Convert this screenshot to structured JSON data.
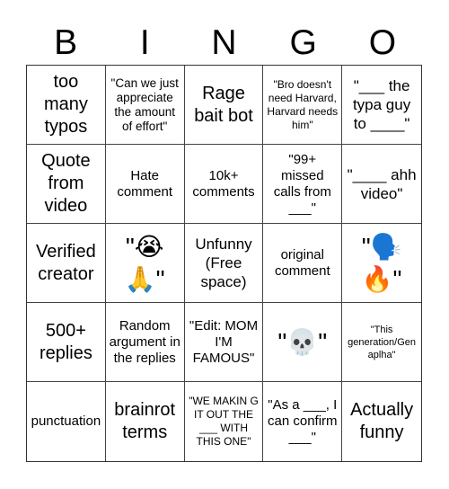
{
  "header": {
    "letters": [
      "B",
      "I",
      "N",
      "G",
      "O"
    ]
  },
  "cells": [
    {
      "text": "too many typos",
      "size": "xl"
    },
    {
      "text": "\"Can we just appreciate the amount of effort\"",
      "size": "sm"
    },
    {
      "text": "Rage bait bot",
      "size": "xl"
    },
    {
      "text": "\"Bro doesn't need Harvard, Harvard needs him\"",
      "size": "xs"
    },
    {
      "text": "\"___ the typa guy to ____\"",
      "size": "lg"
    },
    {
      "text": "Quote from video",
      "size": "xl"
    },
    {
      "text": "Hate comment",
      "size": "md"
    },
    {
      "text": "10k+ comments",
      "size": "md"
    },
    {
      "text": "\"99+ missed calls from ___\"",
      "size": "md"
    },
    {
      "text": "\"____ ahh video\"",
      "size": "lg"
    },
    {
      "text": "Verified creator",
      "size": "xl"
    },
    {
      "text": "\"😭🙏\"",
      "size": "emoji"
    },
    {
      "text": "Unfunny (Free space)",
      "size": "lg"
    },
    {
      "text": "original comment",
      "size": "md"
    },
    {
      "text": "\"🗣️🔥\"",
      "size": "emoji"
    },
    {
      "text": "500+ replies",
      "size": "xl"
    },
    {
      "text": "Random argument in the replies",
      "size": "md"
    },
    {
      "text": "\"Edit: MOM I'M FAMOUS\"",
      "size": "md"
    },
    {
      "text": "\"💀\"",
      "size": "emoji"
    },
    {
      "text": "\"This generation/Gen aplha\"",
      "size": "xxs"
    },
    {
      "text": "punctuation",
      "size": "md"
    },
    {
      "text": "brainrot terms",
      "size": "xl"
    },
    {
      "text": "\"WE MAKIN G IT OUT THE ___ WITH THIS ONE\"",
      "size": "xs"
    },
    {
      "text": "\"As a ___, I can confirm ___\"",
      "size": "md"
    },
    {
      "text": "Actually funny",
      "size": "xl"
    }
  ]
}
